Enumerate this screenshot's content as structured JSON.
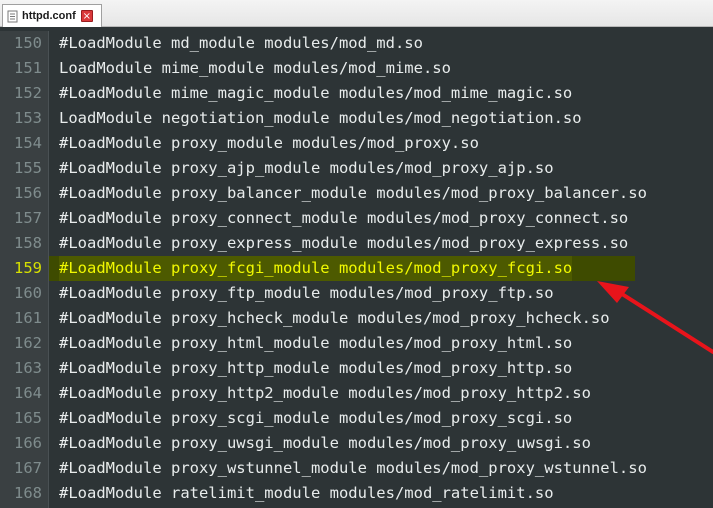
{
  "tab": {
    "label": "httpd.conf",
    "close_glyph": "×"
  },
  "highlight_color": "#f1f900",
  "lines": [
    {
      "num": "150",
      "text": "#LoadModule md_module modules/mod_md.so"
    },
    {
      "num": "151",
      "text": "LoadModule mime_module modules/mod_mime.so"
    },
    {
      "num": "152",
      "text": "#LoadModule mime_magic_module modules/mod_mime_magic.so"
    },
    {
      "num": "153",
      "text": "LoadModule negotiation_module modules/mod_negotiation.so"
    },
    {
      "num": "154",
      "text": "#LoadModule proxy_module modules/mod_proxy.so"
    },
    {
      "num": "155",
      "text": "#LoadModule proxy_ajp_module modules/mod_proxy_ajp.so"
    },
    {
      "num": "156",
      "text": "#LoadModule proxy_balancer_module modules/mod_proxy_balancer.so"
    },
    {
      "num": "157",
      "text": "#LoadModule proxy_connect_module modules/mod_proxy_connect.so"
    },
    {
      "num": "158",
      "text": "#LoadModule proxy_express_module modules/mod_proxy_express.so"
    },
    {
      "num": "159",
      "text": "#LoadModule proxy_fcgi_module modules/mod_proxy_fcgi.so"
    },
    {
      "num": "160",
      "text": "#LoadModule proxy_ftp_module modules/mod_proxy_ftp.so"
    },
    {
      "num": "161",
      "text": "#LoadModule proxy_hcheck_module modules/mod_proxy_hcheck.so"
    },
    {
      "num": "162",
      "text": "#LoadModule proxy_html_module modules/mod_proxy_html.so"
    },
    {
      "num": "163",
      "text": "#LoadModule proxy_http_module modules/mod_proxy_http.so"
    },
    {
      "num": "164",
      "text": "#LoadModule proxy_http2_module modules/mod_proxy_http2.so"
    },
    {
      "num": "165",
      "text": "#LoadModule proxy_scgi_module modules/mod_proxy_scgi.so"
    },
    {
      "num": "166",
      "text": "#LoadModule proxy_uwsgi_module modules/mod_proxy_uwsgi.so"
    },
    {
      "num": "167",
      "text": "#LoadModule proxy_wstunnel_module modules/mod_proxy_wstunnel.so"
    },
    {
      "num": "168",
      "text": "#LoadModule ratelimit_module modules/mod_ratelimit.so"
    }
  ]
}
